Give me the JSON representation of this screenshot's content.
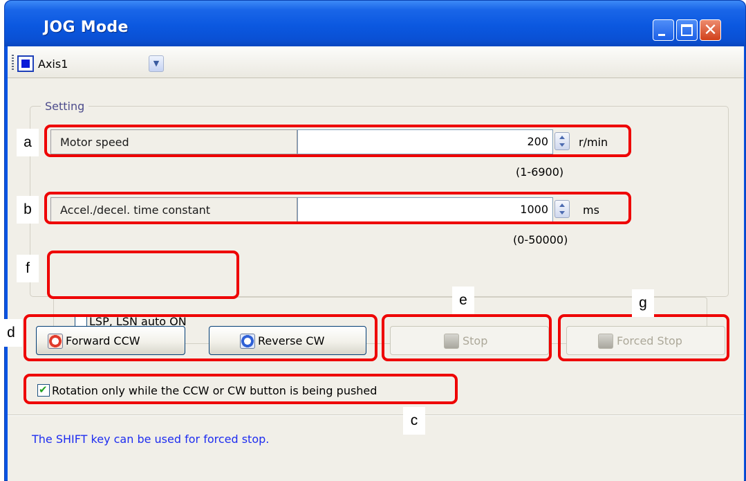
{
  "window": {
    "title": "JOG Mode",
    "controls": {
      "minimize": "minimize-icon",
      "maximize": "maximize-icon",
      "close": "close-icon"
    },
    "close_glyph": "✕"
  },
  "toolbar": {
    "axis_selector": {
      "selected": "Axis1",
      "icon": "axis-square-icon"
    }
  },
  "setting": {
    "legend": "Setting",
    "motor_speed": {
      "label": "Motor speed",
      "value": "200",
      "unit": "r/min",
      "range": "(1-6900)"
    },
    "accel_decel": {
      "label": "Accel./decel. time constant",
      "value": "1000",
      "unit": "ms",
      "range": "(0-50000)"
    },
    "lsp_lsn_auto_on": {
      "label": "LSP, LSN auto ON",
      "checked": false
    }
  },
  "buttons": {
    "forward_ccw": {
      "label": "Forward CCW",
      "enabled": true
    },
    "reverse_cw": {
      "label": "Reverse CW",
      "enabled": true
    },
    "stop": {
      "label": "Stop",
      "enabled": false
    },
    "forced_stop": {
      "label": "Forced Stop",
      "enabled": false
    }
  },
  "rotation_only_while_pushed": {
    "label": "Rotation only while the CCW or CW button is being pushed",
    "checked": true
  },
  "hint": "The SHIFT key can be used for forced stop.",
  "annotations": {
    "a": "a",
    "b": "b",
    "c": "c",
    "d": "d",
    "e": "e",
    "f": "f",
    "g": "g",
    "outline_color": "#ee0000"
  },
  "colors": {
    "titlebar": "#0b58e0",
    "client_bg": "#f1efe8",
    "hint_text": "#1d2cf0",
    "legend_text": "#4d4c8c"
  }
}
